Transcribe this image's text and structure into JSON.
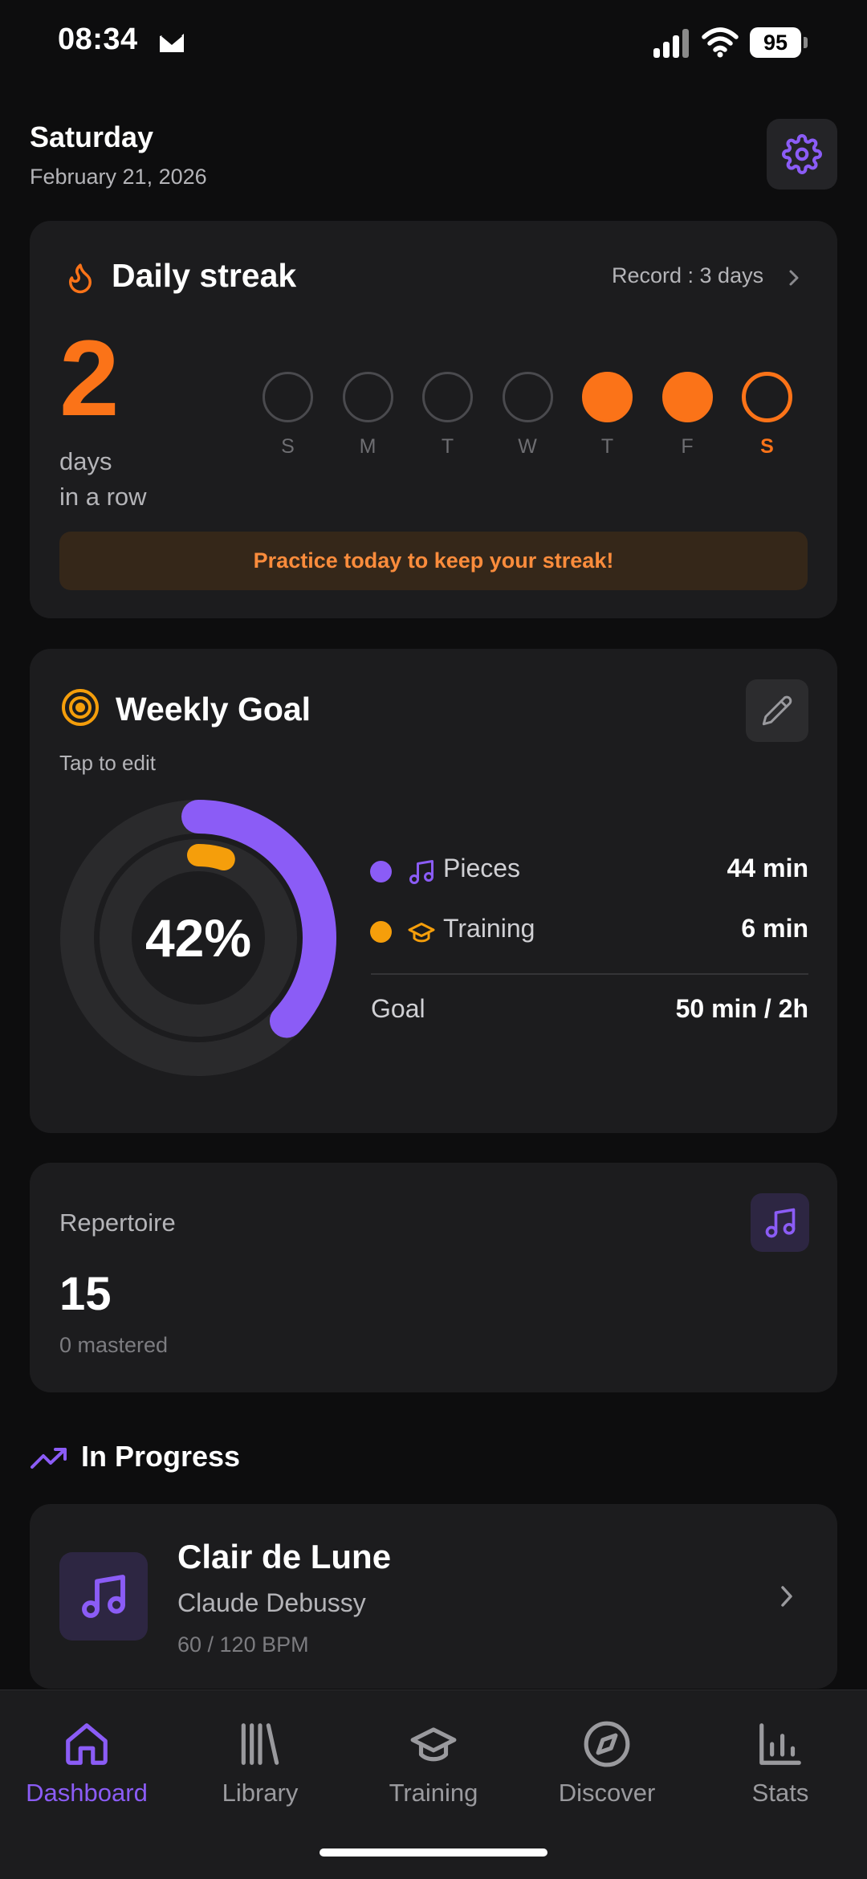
{
  "status_bar": {
    "time": "08:34",
    "battery": "95"
  },
  "header": {
    "day": "Saturday",
    "date": "February 21, 2026"
  },
  "streak": {
    "title": "Daily streak",
    "record": "Record : 3 days",
    "count": "2",
    "sub_line1": "days",
    "sub_line2": "in a row",
    "days": [
      {
        "label": "S",
        "state": "empty"
      },
      {
        "label": "M",
        "state": "empty"
      },
      {
        "label": "T",
        "state": "empty"
      },
      {
        "label": "W",
        "state": "empty"
      },
      {
        "label": "T",
        "state": "done"
      },
      {
        "label": "F",
        "state": "done"
      },
      {
        "label": "S",
        "state": "today"
      }
    ],
    "banner": "Practice today to keep your streak!"
  },
  "weekly_goal": {
    "title": "Weekly Goal",
    "hint": "Tap to edit",
    "percent": "42%",
    "outer_progress": 0.37,
    "inner_progress": 0.05,
    "pieces_label": "Pieces",
    "pieces_value": "44 min",
    "training_label": "Training",
    "training_value": "6 min",
    "goal_label": "Goal",
    "goal_value": "50 min / 2h"
  },
  "repertoire": {
    "title": "Repertoire",
    "count": "15",
    "sub": "0 mastered"
  },
  "in_progress": {
    "title": "In Progress",
    "piece_title": "Clair de Lune",
    "composer": "Claude Debussy",
    "bpm": "60 / 120 BPM"
  },
  "nav": {
    "dashboard": "Dashboard",
    "library": "Library",
    "training": "Training",
    "discover": "Discover",
    "stats": "Stats"
  },
  "colors": {
    "accent_purple": "#8b5cf6",
    "accent_orange": "#fb7318",
    "training_yellow": "#f59e0b",
    "card_bg": "#1c1c1e"
  }
}
